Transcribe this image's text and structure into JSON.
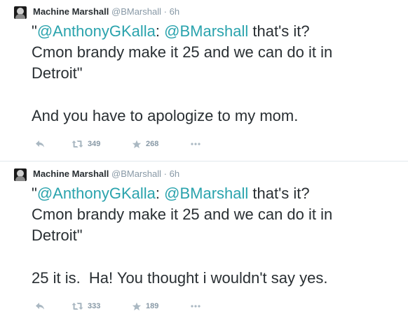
{
  "tweets": [
    {
      "author": {
        "fullname": "Machine Marshall",
        "username": "@BMarshall",
        "separator": "·",
        "time": "6h"
      },
      "text": {
        "quote_open": "\"",
        "mention_1": "@AnthonyGKalla",
        "colon": ":",
        "mention_2": "@BMarshall",
        "line_1_rest": " that's it?",
        "line_2": "Cmon brandy make it 25 and we can do it in",
        "line_3": "Detroit\"",
        "reply": "And you have to apologize to my mom."
      },
      "stats": {
        "retweets": "349",
        "favorites": "268"
      },
      "icons": [
        "reply-icon",
        "retweet-icon",
        "favorite-icon",
        "more-icon"
      ]
    },
    {
      "author": {
        "fullname": "Machine Marshall",
        "username": "@BMarshall",
        "separator": "·",
        "time": "6h"
      },
      "text": {
        "quote_open": "\"",
        "mention_1": "@AnthonyGKalla",
        "colon": ":",
        "mention_2": "@BMarshall",
        "line_1_rest": " that's it?",
        "line_2": "Cmon brandy make it 25 and we can do it in",
        "line_3": "Detroit\"",
        "reply": "25 it is.  Ha! You thought i wouldn't say yes."
      },
      "stats": {
        "retweets": "333",
        "favorites": "189"
      },
      "icons": [
        "reply-icon",
        "retweet-icon",
        "favorite-icon",
        "more-icon"
      ]
    }
  ],
  "colors": {
    "mention": "#2aa3ad",
    "text": "#292f33",
    "meta": "#8899a6",
    "icon": "#aab8c2",
    "divider": "#e1e8ed"
  }
}
